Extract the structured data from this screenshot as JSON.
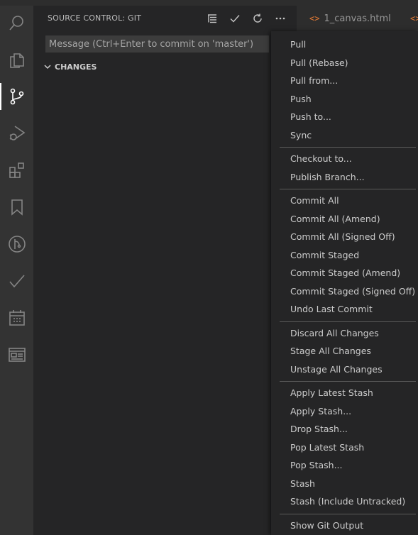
{
  "sidebar": {
    "title": "SOURCE CONTROL: GIT",
    "commit_placeholder": "Message (Ctrl+Enter to commit on 'master')",
    "section": "CHANGES"
  },
  "activity_bar": {
    "items": [
      {
        "icon": "search-icon"
      },
      {
        "icon": "files-icon"
      },
      {
        "icon": "source-control-icon",
        "active": true
      },
      {
        "icon": "run-debug-icon"
      },
      {
        "icon": "extensions-icon"
      },
      {
        "icon": "bookmark-icon"
      },
      {
        "icon": "git-graph-icon"
      },
      {
        "icon": "checkmark-icon"
      },
      {
        "icon": "calendar-icon"
      },
      {
        "icon": "browser-preview-icon"
      }
    ]
  },
  "header_actions": [
    "view-as-tree-icon",
    "commit-check-icon",
    "refresh-icon",
    "more-actions-icon"
  ],
  "tabs": [
    {
      "label": "1_canvas.html",
      "icon": "<>"
    },
    {
      "label": "",
      "icon": "<>"
    }
  ],
  "menu": {
    "groups": [
      [
        "Pull",
        "Pull (Rebase)",
        "Pull from...",
        "Push",
        "Push to...",
        "Sync"
      ],
      [
        "Checkout to...",
        "Publish Branch..."
      ],
      [
        "Commit All",
        "Commit All (Amend)",
        "Commit All (Signed Off)",
        "Commit Staged",
        "Commit Staged (Amend)",
        "Commit Staged (Signed Off)",
        "Undo Last Commit"
      ],
      [
        "Discard All Changes",
        "Stage All Changes",
        "Unstage All Changes"
      ],
      [
        "Apply Latest Stash",
        "Apply Stash...",
        "Drop Stash...",
        "Pop Latest Stash",
        "Pop Stash...",
        "Stash",
        "Stash (Include Untracked)"
      ],
      [
        "Show Git Output"
      ]
    ]
  },
  "colors": {
    "accent_code_icon": "#e37933",
    "background": "#252526",
    "activity_bar": "#333333"
  }
}
